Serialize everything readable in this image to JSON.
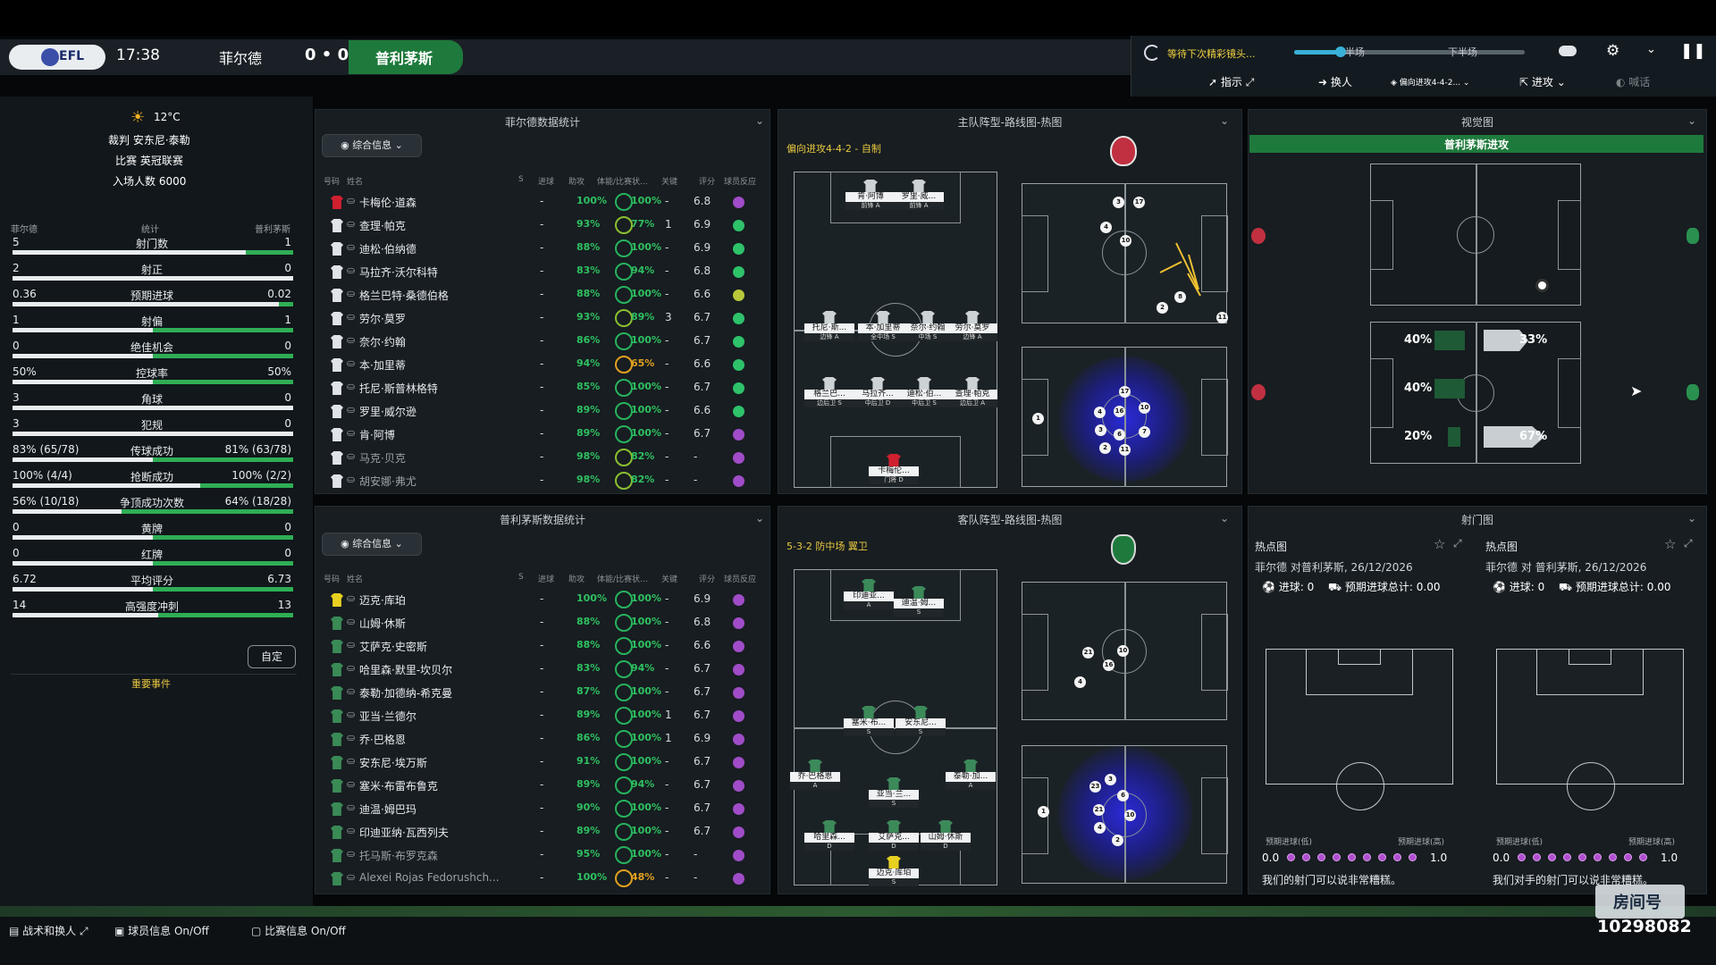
{
  "header": {
    "league_badge": "EFL",
    "time": "17:38",
    "home_team": "菲尔德",
    "score": "0 • 0",
    "away_team": "普利茅斯"
  },
  "right_controls": {
    "status": "等待下次精彩镜头...",
    "first_half": "半场",
    "second_half": "下半场",
    "menu": [
      "指示",
      "换人",
      "偏向进攻4-4-2...",
      "进攻",
      "喊话"
    ]
  },
  "match_info": {
    "temperature": "12°C",
    "referee": "裁判 安东尼·泰勒",
    "competition": "比赛 英冠联赛",
    "attendance": "入场人数 6000"
  },
  "stats": {
    "home_label": "菲尔德",
    "center_label": "统计",
    "away_label": "普利茅斯",
    "rows": [
      {
        "home": "5",
        "name": "射门数",
        "away": "1",
        "home_share": 0.83
      },
      {
        "home": "2",
        "name": "射正",
        "away": "0",
        "home_share": 1.0
      },
      {
        "home": "0.36",
        "name": "预期进球",
        "away": "0.02",
        "home_share": 0.95
      },
      {
        "home": "1",
        "name": "射偏",
        "away": "1",
        "home_share": 0.5
      },
      {
        "home": "0",
        "name": "绝佳机会",
        "away": "0",
        "home_share": 0.5
      },
      {
        "home": "50%",
        "name": "控球率",
        "away": "50%",
        "home_share": 0.5
      },
      {
        "home": "3",
        "name": "角球",
        "away": "0",
        "home_share": 1.0
      },
      {
        "home": "3",
        "name": "犯规",
        "away": "0",
        "home_share": 1.0
      },
      {
        "home": "83% (65/78)",
        "name": "传球成功",
        "away": "81% (63/78)",
        "home_share": 0.5
      },
      {
        "home": "100% (4/4)",
        "name": "抢断成功",
        "away": "100% (2/2)",
        "home_share": 0.67
      },
      {
        "home": "56% (10/18)",
        "name": "争顶成功次数",
        "away": "64% (18/28)",
        "home_share": 0.39
      },
      {
        "home": "0",
        "name": "黄牌",
        "away": "0",
        "home_share": 0.5
      },
      {
        "home": "0",
        "name": "红牌",
        "away": "0",
        "home_share": 0.5
      },
      {
        "home": "6.72",
        "name": "平均评分",
        "away": "6.73",
        "home_share": 0.5
      },
      {
        "home": "14",
        "name": "高强度冲刺",
        "away": "13",
        "home_share": 0.52
      }
    ],
    "custom_button": "自定",
    "events_label": "重要事件"
  },
  "home_table": {
    "title": "菲尔德数据统计",
    "dropdown": "综合信息",
    "columns": [
      "号码",
      "姓名",
      "S",
      "进球",
      "助攻",
      "体能/比赛状...",
      "关键",
      "评分",
      "球员反应"
    ],
    "players": [
      {
        "name": "卡梅伦·道森",
        "goals": "-",
        "fit": "100%",
        "cond": "100%",
        "key": "-",
        "rating": "6.8",
        "react": "#a04cc8",
        "gk": true
      },
      {
        "name": "查理·帕克",
        "goals": "-",
        "fit": "93%",
        "cond": "77%",
        "key": "1",
        "rating": "6.9",
        "react": "#2ec26a"
      },
      {
        "name": "迪松·伯纳德",
        "goals": "-",
        "fit": "88%",
        "cond": "100%",
        "key": "-",
        "rating": "6.9",
        "react": "#2ec26a"
      },
      {
        "name": "马拉齐·沃尔科特",
        "goals": "-",
        "fit": "83%",
        "cond": "94%",
        "key": "-",
        "rating": "6.8",
        "react": "#2ec26a"
      },
      {
        "name": "格兰巴特·桑德伯格",
        "goals": "-",
        "fit": "88%",
        "cond": "100%",
        "key": "-",
        "rating": "6.6",
        "react": "#b8c83a"
      },
      {
        "name": "劳尔·莫罗",
        "goals": "-",
        "fit": "93%",
        "cond": "89%",
        "key": "3",
        "rating": "6.7",
        "react": "#2ec26a"
      },
      {
        "name": "奈尔·约翰",
        "goals": "-",
        "fit": "86%",
        "cond": "100%",
        "key": "-",
        "rating": "6.7",
        "react": "#2ec26a"
      },
      {
        "name": "本·加里蒂",
        "goals": "-",
        "fit": "94%",
        "cond": "65%",
        "key": "-",
        "rating": "6.6",
        "react": "#2ec26a"
      },
      {
        "name": "托尼·斯普林格特",
        "goals": "-",
        "fit": "85%",
        "cond": "100%",
        "key": "-",
        "rating": "6.7",
        "react": "#2ec26a"
      },
      {
        "name": "罗里·威尔逊",
        "goals": "-",
        "fit": "89%",
        "cond": "100%",
        "key": "-",
        "rating": "6.6",
        "react": "#2ec26a"
      },
      {
        "name": "肯·阿博",
        "goals": "-",
        "fit": "89%",
        "cond": "100%",
        "key": "-",
        "rating": "6.7",
        "react": "#a04cc8"
      },
      {
        "name": "马克·贝克",
        "goals": "-",
        "fit": "98%",
        "cond": "82%",
        "key": "-",
        "rating": "-",
        "react": "#a04cc8",
        "sub": true
      },
      {
        "name": "胡安娜·弗尤",
        "goals": "-",
        "fit": "98%",
        "cond": "82%",
        "key": "-",
        "rating": "-",
        "react": "#a04cc8",
        "sub": true
      }
    ]
  },
  "away_table": {
    "title": "普利茅斯数据统计",
    "dropdown": "综合信息",
    "columns": [
      "号码",
      "姓名",
      "S",
      "进球",
      "助攻",
      "体能/比赛状...",
      "关键",
      "评分",
      "球员反应"
    ],
    "players": [
      {
        "name": "迈克·库珀",
        "goals": "-",
        "fit": "100%",
        "cond": "100%",
        "key": "-",
        "rating": "6.9",
        "react": "#a04cc8",
        "gk": true
      },
      {
        "name": "山姆·休斯",
        "goals": "-",
        "fit": "88%",
        "cond": "100%",
        "key": "-",
        "rating": "6.8",
        "react": "#a04cc8"
      },
      {
        "name": "艾萨克·史密斯",
        "goals": "-",
        "fit": "88%",
        "cond": "100%",
        "key": "-",
        "rating": "6.6",
        "react": "#a04cc8"
      },
      {
        "name": "哈里森·默里-坎贝尔",
        "goals": "-",
        "fit": "83%",
        "cond": "94%",
        "key": "-",
        "rating": "6.7",
        "react": "#a04cc8"
      },
      {
        "name": "泰勒·加德纳-希克曼",
        "goals": "-",
        "fit": "87%",
        "cond": "100%",
        "key": "-",
        "rating": "6.7",
        "react": "#a04cc8"
      },
      {
        "name": "亚当·兰德尔",
        "goals": "-",
        "fit": "89%",
        "cond": "100%",
        "key": "1",
        "rating": "6.7",
        "react": "#a04cc8"
      },
      {
        "name": "乔·巴格恩",
        "goals": "-",
        "fit": "86%",
        "cond": "100%",
        "key": "1",
        "rating": "6.9",
        "react": "#a04cc8"
      },
      {
        "name": "安东尼·埃万斯",
        "goals": "-",
        "fit": "91%",
        "cond": "100%",
        "key": "-",
        "rating": "6.7",
        "react": "#a04cc8"
      },
      {
        "name": "塞米·布雷布鲁克",
        "goals": "-",
        "fit": "89%",
        "cond": "94%",
        "key": "-",
        "rating": "6.7",
        "react": "#a04cc8"
      },
      {
        "name": "迪温·姆巴玛",
        "goals": "-",
        "fit": "90%",
        "cond": "100%",
        "key": "-",
        "rating": "6.7",
        "react": "#a04cc8"
      },
      {
        "name": "印迪亚纳·瓦西列夫",
        "goals": "-",
        "fit": "89%",
        "cond": "100%",
        "key": "-",
        "rating": "6.7",
        "react": "#a04cc8"
      },
      {
        "name": "托马斯·布罗克森",
        "goals": "-",
        "fit": "95%",
        "cond": "100%",
        "key": "-",
        "rating": "-",
        "react": "#a04cc8",
        "sub": true
      },
      {
        "name": "Alexei Rojas Fedorushch...",
        "goals": "-",
        "fit": "100%",
        "cond": "48%",
        "key": "-",
        "rating": "-",
        "react": "#a04cc8",
        "sub": true
      }
    ]
  },
  "home_formation": {
    "title": "主队阵型-路线图-热图",
    "tactic": "偏向进攻4-4-2 - 自制",
    "players": [
      {
        "name": "肯·阿博",
        "pos": "前锋",
        "r": "A"
      },
      {
        "name": "罗里·威...",
        "pos": "前锋",
        "r": "A"
      },
      {
        "name": "托尼·斯...",
        "pos": "边锋",
        "r": "A"
      },
      {
        "name": "本·加里蒂",
        "pos": "全中场",
        "r": "S"
      },
      {
        "name": "奈尔·约翰",
        "pos": "中场",
        "r": "S"
      },
      {
        "name": "劳尔·莫罗",
        "pos": "边锋",
        "r": "A"
      },
      {
        "name": "格兰巴...",
        "pos": "边后卫",
        "r": "S"
      },
      {
        "name": "马拉齐...",
        "pos": "中后卫",
        "r": "D"
      },
      {
        "name": "迪松·伯...",
        "pos": "中后卫",
        "r": "S"
      },
      {
        "name": "查理·帕克",
        "pos": "边后卫",
        "r": "A"
      },
      {
        "name": "卡梅伦...",
        "pos": "门将",
        "r": "D"
      }
    ],
    "route_nums": [
      "3",
      "17",
      "4",
      "10",
      "8",
      "2",
      "11"
    ],
    "heat_nums": [
      "17",
      "1",
      "16",
      "4",
      "10",
      "6",
      "7",
      "3",
      "2",
      "11"
    ]
  },
  "away_formation": {
    "title": "客队阵型-路线图-热图",
    "tactic": "5-3-2 防中场 翼卫",
    "players": [
      {
        "name": "印迪亚...",
        "pos": "",
        "r": "A"
      },
      {
        "name": "迪温·姆...",
        "pos": "",
        "r": "S"
      },
      {
        "name": "塞米·布...",
        "pos": "",
        "r": "S"
      },
      {
        "name": "安东尼...",
        "pos": "",
        "r": "S"
      },
      {
        "name": "乔·巴格恩",
        "pos": "",
        "r": "A"
      },
      {
        "name": "亚当·兰...",
        "pos": "",
        "r": "S"
      },
      {
        "name": "泰勒·加...",
        "pos": "",
        "r": "A"
      },
      {
        "name": "哈里森...",
        "pos": "",
        "r": "D"
      },
      {
        "name": "艾萨克...",
        "pos": "",
        "r": "D"
      },
      {
        "name": "山姆·休斯",
        "pos": "",
        "r": "D"
      },
      {
        "name": "迈克·库珀",
        "pos": "",
        "r": "S"
      }
    ],
    "route_nums": [
      "21",
      "16",
      "10",
      "4"
    ],
    "heat_nums": [
      "23",
      "3",
      "21",
      "6",
      "10",
      "1",
      "4",
      "2"
    ]
  },
  "view": {
    "title": "视觉图",
    "banner": "普利茅斯进攻",
    "zones_left": [
      "40%",
      "40%",
      "20%"
    ],
    "zones_right": [
      "33%",
      "67%"
    ]
  },
  "shots": {
    "title": "射门图",
    "cards": [
      {
        "title": "热点图",
        "match": "菲尔德 对普利茅斯, 26/12/2026",
        "goals": "进球: 0",
        "xg": "预期进球总计: 0.00",
        "low": "预期进球(低)",
        "high": "预期进球(高)",
        "min": "0.0",
        "max": "1.0",
        "comment": "我们的射门可以说非常糟糕。"
      },
      {
        "title": "热点图",
        "match": "菲尔德 对 普利茅斯, 26/12/2026",
        "goals": "进球: 0",
        "xg": "预期进球总计: 0.00",
        "low": "预期进球(低)",
        "high": "预期进球(高)",
        "min": "0.0",
        "max": "1.0",
        "comment": "我们对手的射门可以说非常糟糕。"
      }
    ]
  },
  "bottom": {
    "tactics": "战术和换人",
    "player_info": "球员信息 On/Off",
    "match_info": "比赛信息 On/Off",
    "watermark": "房间号",
    "room": "10298082"
  },
  "colors": {
    "accent_green": "#1e7a3c",
    "bar_green": "#2fae55",
    "react_purple": "#a04cc8"
  }
}
